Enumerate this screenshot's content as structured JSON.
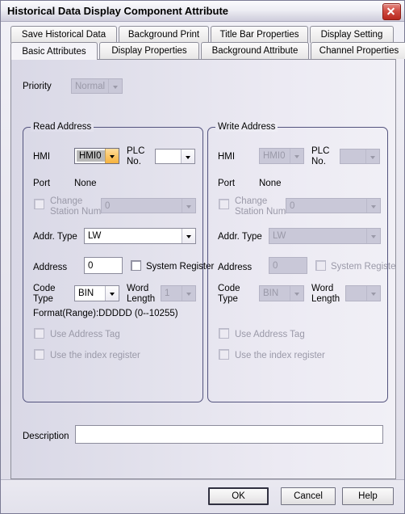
{
  "window": {
    "title": "Historical Data Display Component Attribute",
    "close_icon": "close-icon"
  },
  "tabs": {
    "row1": [
      {
        "label": "Save Historical Data",
        "active": false
      },
      {
        "label": "Background Print",
        "active": false
      },
      {
        "label": "Title Bar Properties",
        "active": false
      },
      {
        "label": "Display Setting",
        "active": false
      }
    ],
    "row2": [
      {
        "label": "Basic Attributes",
        "active": true
      },
      {
        "label": "Display Properties",
        "active": false
      },
      {
        "label": "Background Attribute",
        "active": false
      },
      {
        "label": "Channel Properties",
        "active": false
      }
    ]
  },
  "basic": {
    "priority": {
      "label": "Priority",
      "value": "Normal",
      "enabled": false
    },
    "read_address": {
      "title": "Read Address",
      "hmi_label": "HMI",
      "hmi_value": "HMI0",
      "plc_label": "PLC\nNo.",
      "plc_label_line1": "PLC",
      "plc_label_line2": "No.",
      "plc_value": "",
      "port_label": "Port",
      "port_value": "None",
      "change_station_label_line1": "Change",
      "change_station_label_line2": "Station Num",
      "change_station_checked": false,
      "station_value": "0",
      "addr_type_label": "Addr. Type",
      "addr_type_value": "LW",
      "address_label": "Address",
      "address_value": "0",
      "system_register_label": "System Register",
      "system_register_checked": false,
      "code_type_label_line1": "Code",
      "code_type_label_line2": "Type",
      "code_type_value": "BIN",
      "word_length_label_line1": "Word",
      "word_length_label_line2": "Length",
      "word_length_value": "1",
      "format_text": "Format(Range):DDDDD (0--10255)",
      "use_address_tag_label": "Use Address Tag",
      "use_address_tag_checked": false,
      "use_index_register_label": "Use the index register",
      "use_index_register_checked": false
    },
    "write_address": {
      "title": "Write Address",
      "hmi_label": "HMI",
      "hmi_value": "HMI0",
      "plc_label_line1": "PLC",
      "plc_label_line2": "No.",
      "plc_value": "",
      "port_label": "Port",
      "port_value": "None",
      "change_station_label_line1": "Change",
      "change_station_label_line2": "Station Num",
      "change_station_checked": false,
      "station_value": "0",
      "addr_type_label": "Addr. Type",
      "addr_type_value": "LW",
      "address_label": "Address",
      "address_value": "0",
      "system_register_label": "System Register",
      "system_register_checked": false,
      "code_type_label_line1": "Code",
      "code_type_label_line2": "Type",
      "code_type_value": "BIN",
      "word_length_label_line1": "Word",
      "word_length_label_line2": "Length",
      "word_length_value": "",
      "use_address_tag_label": "Use Address Tag",
      "use_address_tag_checked": false,
      "use_index_register_label": "Use the index register",
      "use_index_register_checked": false
    },
    "description": {
      "label": "Description",
      "value": "",
      "placeholder": ""
    }
  },
  "buttons": {
    "ok": "OK",
    "cancel": "Cancel",
    "help": "Help"
  },
  "colors": {
    "titlebar_gradient_top": "#fbfbfd",
    "titlebar_gradient_bottom": "#cfcddc",
    "close_red": "#b8281e",
    "group_border": "#53537e",
    "combo_highlight_orange": "#f5b23f",
    "page_bg_left": "#d9d8e6",
    "page_bg_right": "#f1f0f6",
    "disabled_text": "#9a99a8",
    "disabled_field": "#c9c8d8"
  }
}
